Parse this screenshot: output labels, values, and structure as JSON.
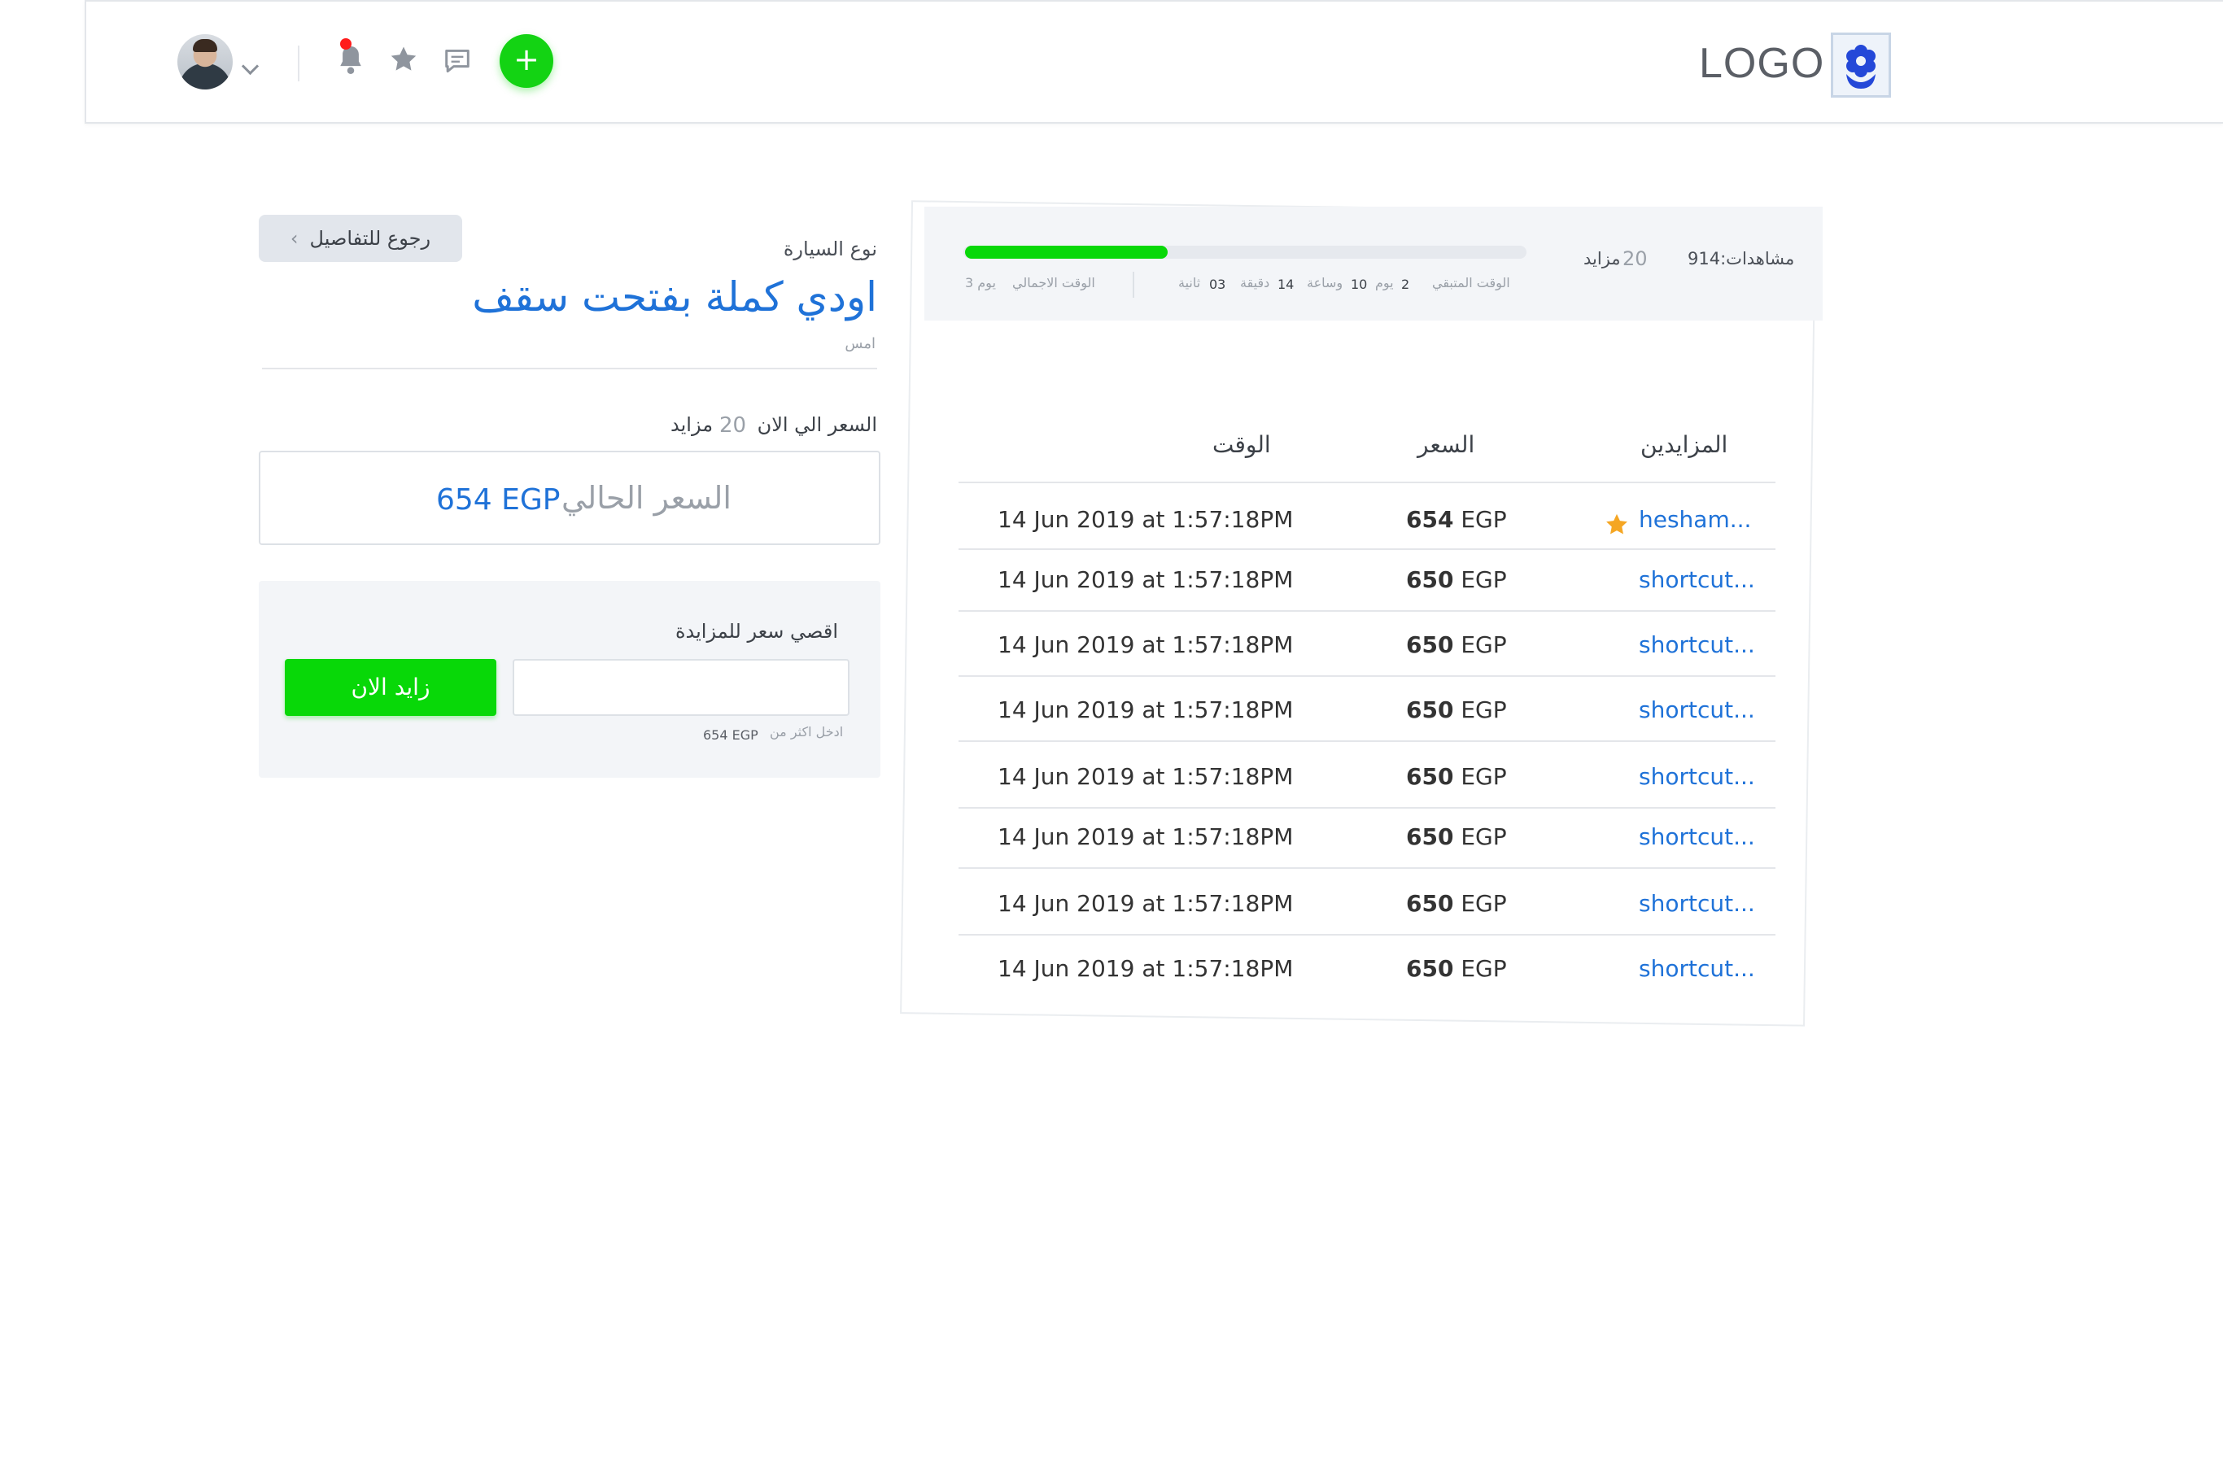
{
  "header": {
    "logo_text": "LOGO",
    "add_button_label": "+",
    "icons": [
      "avatar",
      "chevron-down-icon",
      "bell-icon",
      "star-icon",
      "chat-icon",
      "plus-icon",
      "flower-logo-icon"
    ],
    "notification_dot_color": "#ff1c1c",
    "accent_green": "#13d313",
    "brand_blue": "#1f72d8"
  },
  "details": {
    "back_button_label": "رجوع للتفاصيل",
    "car_type_label": "نوع السيارة",
    "car_title": "اودي كملة بفتحت سقف",
    "date_text": "امس",
    "now_price_label": "السعر الي الان",
    "bids_count": "20",
    "bids_label": "مزايد",
    "current_price_label": "السعر الحالي",
    "current_price_value": "654 EGP"
  },
  "bid_form": {
    "max_price_label": "اقصي سعر للمزايدة",
    "input_value": "",
    "submit_label": "زايد الان",
    "hint_label": "ادخل اكثر من",
    "hint_value": "654 EGP"
  },
  "stats": {
    "views_text": "مشاهدات:914",
    "bids_count": "20",
    "bids_label": "مزايد",
    "progress": 0.36,
    "remaining_label": "الوقت المتبقي",
    "days_value": "2",
    "days_unit": "يوم",
    "hours_value": "10",
    "hours_unit": "وساعة",
    "minutes_value": "14",
    "minutes_unit": "دقيقة",
    "seconds_value": "03",
    "seconds_unit": "ثانية",
    "total_label": "الوقت الاجمالي",
    "total_value": "3 يوم"
  },
  "table": {
    "headers": {
      "bidders": "المزايدين",
      "price": "السعر",
      "time": "الوقت"
    },
    "rows": [
      {
        "bidder": "hesham...",
        "price": "654",
        "currency": "EGP",
        "time": "14 Jun 2019 at 1:57:18PM",
        "starred": true
      },
      {
        "bidder": "shortcut...",
        "price": "650",
        "currency": "EGP",
        "time": "14 Jun 2019 at 1:57:18PM",
        "starred": false
      },
      {
        "bidder": "shortcut...",
        "price": "650",
        "currency": "EGP",
        "time": "14 Jun 2019 at 1:57:18PM",
        "starred": false
      },
      {
        "bidder": "shortcut...",
        "price": "650",
        "currency": "EGP",
        "time": "14 Jun 2019 at 1:57:18PM",
        "starred": false
      },
      {
        "bidder": "shortcut...",
        "price": "650",
        "currency": "EGP",
        "time": "14 Jun 2019 at 1:57:18PM",
        "starred": false
      },
      {
        "bidder": "shortcut...",
        "price": "650",
        "currency": "EGP",
        "time": "14 Jun 2019 at 1:57:18PM",
        "starred": false
      },
      {
        "bidder": "shortcut...",
        "price": "650",
        "currency": "EGP",
        "time": "14 Jun 2019 at 1:57:18PM",
        "starred": false
      },
      {
        "bidder": "shortcut...",
        "price": "650",
        "currency": "EGP",
        "time": "14 Jun 2019 at 1:57:18PM",
        "starred": false
      }
    ],
    "star_color": "#f5a623"
  }
}
